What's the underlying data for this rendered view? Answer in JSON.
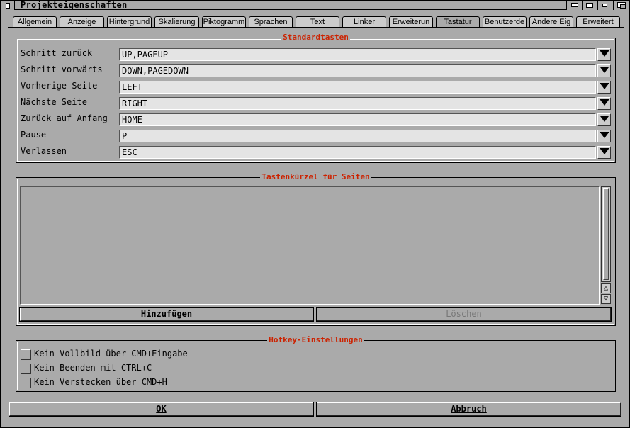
{
  "window": {
    "title": "Projekteigenschaften"
  },
  "tabs": [
    {
      "label": "Allgemein"
    },
    {
      "label": "Anzeige"
    },
    {
      "label": "Hintergrund"
    },
    {
      "label": "Skalierung"
    },
    {
      "label": "Piktogramm"
    },
    {
      "label": "Sprachen"
    },
    {
      "label": "Text"
    },
    {
      "label": "Linker"
    },
    {
      "label": "Erweiterun"
    },
    {
      "label": "Tastatur"
    },
    {
      "label": "Benutzerde"
    },
    {
      "label": "Andere Eig"
    },
    {
      "label": "Erweitert"
    }
  ],
  "active_tab": "Tastatur",
  "standard": {
    "title": "Standardtasten",
    "rows": [
      {
        "label": "Schritt zurück",
        "value": "UP,PAGEUP"
      },
      {
        "label": "Schritt vorwärts",
        "value": "DOWN,PAGEDOWN"
      },
      {
        "label": "Vorherige Seite",
        "value": "LEFT"
      },
      {
        "label": "Nächste Seite",
        "value": "RIGHT"
      },
      {
        "label": "Zurück auf Anfang",
        "value": "HOME"
      },
      {
        "label": "Pause",
        "value": "P"
      },
      {
        "label": "Verlassen",
        "value": "ESC"
      }
    ]
  },
  "shortcuts": {
    "title": "Tastenkürzel für Seiten",
    "add_label": "Hinzufügen",
    "delete_label": "Löschen",
    "scroll_up_glyph": "△",
    "scroll_down_glyph": "▽"
  },
  "hotkeys": {
    "title": "Hotkey-Einstellungen",
    "options": [
      {
        "label": "Kein Vollbild über CMD+Eingabe",
        "checked": false
      },
      {
        "label": "Kein Beenden mit CTRL+C",
        "checked": false
      },
      {
        "label": "Kein Verstecken über CMD+H",
        "checked": false
      }
    ]
  },
  "footer": {
    "ok_label": "OK",
    "cancel_label": "Abbruch"
  },
  "colors": {
    "background": "#aaaaaa",
    "panel": "#cccccc",
    "group_title": "#cc2200"
  }
}
